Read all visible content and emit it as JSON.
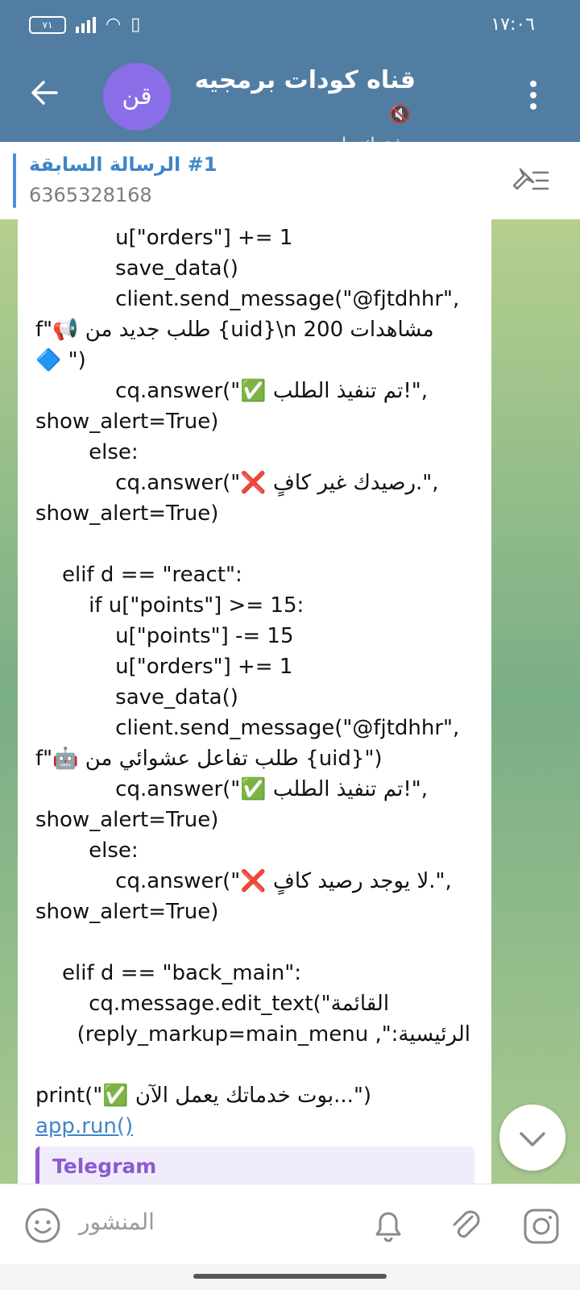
{
  "status": {
    "time": "١٧:٠٦",
    "battery": "٧١"
  },
  "header": {
    "title": "قناه كودات برمجيه",
    "subtitle": "مشترك واحد",
    "avatar_text": "قن"
  },
  "pinned": {
    "title": "#1 الرسالة السابقة",
    "text": "6365328168"
  },
  "code_lines": [
    "            u[\"orders\"] += 1",
    "            save_data()",
    "            client.send_message(\"@fjtdhhr\",",
    "f\"📢 طلب جديد من {uid}\\n مشاهدات 200",
    "🔷 \")",
    "            cq.answer(\"✅ تم تنفيذ الطلب!\",",
    "show_alert=True)",
    "        else:",
    "            cq.answer(\"❌ رصيدك غير كافٍ.\",",
    "show_alert=True)",
    "",
    "    elif d == \"react\":",
    "        if u[\"points\"] >= 15:",
    "            u[\"points\"] -= 15",
    "            u[\"orders\"] += 1",
    "            save_data()",
    "            client.send_message(\"@fjtdhhr\",",
    "f\"🤖 طلب تفاعل عشوائي من {uid}\")",
    "            cq.answer(\"✅ تم تنفيذ الطلب!\",",
    "show_alert=True)",
    "        else:",
    "            cq.answer(\"❌ لا يوجد رصيد كافٍ.\",",
    "show_alert=True)",
    "",
    "    elif d == \"back_main\":",
    "        cq.message.edit_text(\"القائمة",
    "الرئيسية:\", reply_markup=main_menu)",
    "",
    "print(\"✅ بوت خدماتك يعمل الآن...\")",
    "app.run()"
  ],
  "preview": {
    "label": "Telegram"
  },
  "bottom": {
    "placeholder": "المنشور"
  },
  "colors": {
    "header": "#517da2",
    "accent": "#3f86c7",
    "preview": "#8b5bd1"
  }
}
